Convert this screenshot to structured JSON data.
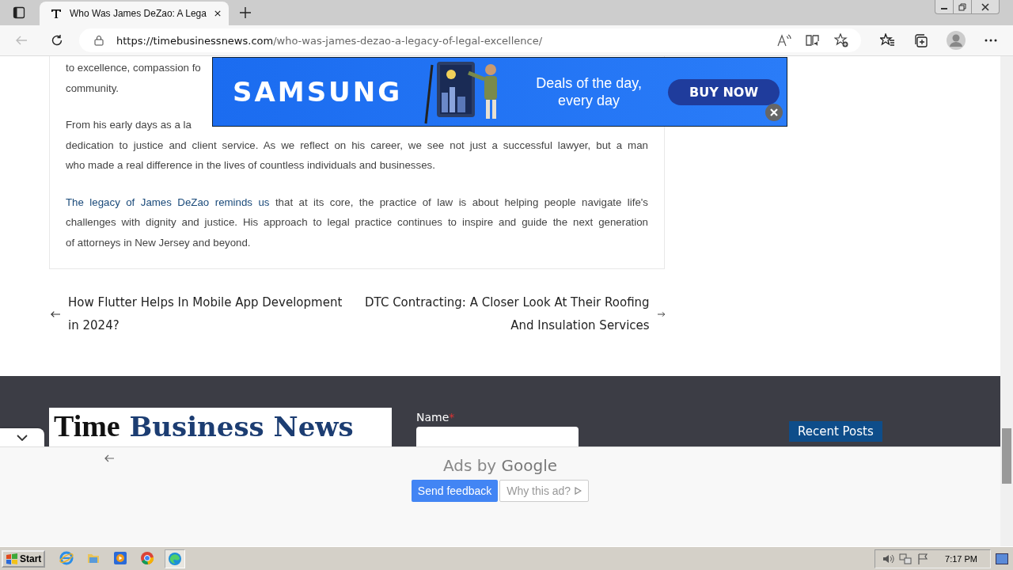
{
  "browser": {
    "tabs": [
      {
        "title": "Who Was James DeZao: A Lega",
        "selected": true
      }
    ],
    "address": {
      "host": "https://timebusinessnews.com",
      "path": "/who-was-james-dezao-a-legacy-of-legal-excellence/"
    }
  },
  "article": {
    "paragraphs": [
      {
        "lines": [
          [
            {
              "text": "to excellence, compassion fo"
            }
          ],
          [
            {
              "text": "community."
            }
          ]
        ]
      },
      {
        "lines": [
          [
            {
              "text": "From his early days as a la"
            }
          ],
          [
            {
              "text": "dedication to justice and client service. As we reflect on his career, we see not just a successful lawyer, but a man"
            }
          ],
          [
            {
              "text": "who made a real difference in the lives of countless individuals and businesses."
            }
          ]
        ]
      },
      {
        "lines": [
          [
            {
              "text": "The legacy of James DeZao reminds us",
              "link": true
            },
            {
              "text": " that at its core, the practice of law is about helping people navigate life's"
            }
          ],
          [
            {
              "text": "challenges with dignity and justice. His approach to legal practice continues to inspire and guide the next generation"
            }
          ],
          [
            {
              "text": "of attorneys in New Jersey and beyond."
            }
          ]
        ]
      }
    ]
  },
  "post_nav": {
    "previous": "How Flutter Helps In Mobile App Development in 2024?",
    "next": "DTC Contracting: A Closer Look At Their Roofing And Insulation Services"
  },
  "ad_banner": {
    "brand": "SAMSUNG",
    "tagline": [
      "Deals of the day,",
      "every day"
    ],
    "button": "BUY NOW"
  },
  "footer": {
    "logo": {
      "blackletter": "Time",
      "rest": "Business News"
    },
    "form": {
      "label": "Name",
      "required_mark": "*"
    },
    "widget_title": "Recent Posts"
  },
  "bottom_ad": {
    "title_prefix": "Ads by",
    "title_brand": "Google",
    "feedback_button": "Send feedback",
    "why_button": "Why this ad?"
  },
  "taskbar": {
    "start": "Start",
    "apps": [
      {
        "kind": "ie",
        "selected": false
      },
      {
        "kind": "folder",
        "selected": false
      },
      {
        "kind": "media",
        "selected": false
      },
      {
        "kind": "chrome",
        "selected": false
      },
      {
        "kind": "edge",
        "selected": true
      }
    ],
    "clock": "7:17 PM"
  }
}
